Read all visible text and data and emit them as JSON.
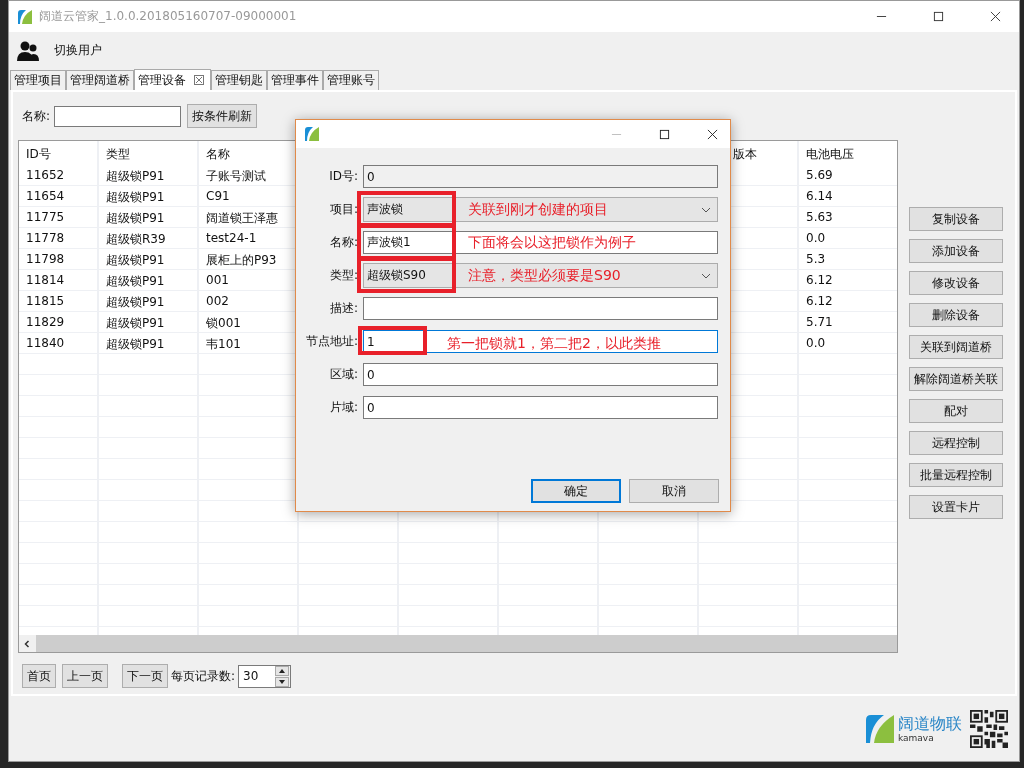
{
  "window": {
    "title": "阔道云管家_1.0.0.201805160707-09000001"
  },
  "toolbar": {
    "switch_user": "切换用户"
  },
  "tabs": [
    {
      "label": "管理项目",
      "selected": false,
      "closable": false
    },
    {
      "label": "管理阔道桥",
      "selected": false,
      "closable": false
    },
    {
      "label": "管理设备",
      "selected": true,
      "closable": true
    },
    {
      "label": "管理钥匙",
      "selected": false,
      "closable": false
    },
    {
      "label": "管理事件",
      "selected": false,
      "closable": false
    },
    {
      "label": "管理账号",
      "selected": false,
      "closable": false
    }
  ],
  "filter": {
    "label": "名称:",
    "button": "按条件刷新"
  },
  "table": {
    "columns": [
      {
        "label": "ID号"
      },
      {
        "label": "类型"
      },
      {
        "label": "名称"
      },
      {},
      {},
      {},
      {},
      {
        "label": "版本"
      },
      {
        "label": "电池电压"
      }
    ],
    "rows": [
      {
        "id": "11652",
        "type": "超级锁P91",
        "name": "子账号测试",
        "battery_voltage": "5.69"
      },
      {
        "id": "11654",
        "type": "超级锁P91",
        "name": "C91",
        "battery_voltage": "6.14"
      },
      {
        "id": "11775",
        "type": "超级锁P91",
        "name": "阔道锁王泽惠",
        "battery_voltage": "5.63"
      },
      {
        "id": "11778",
        "type": "超级锁R39",
        "name": "test24-1",
        "battery_voltage": "0.0"
      },
      {
        "id": "11798",
        "type": "超级锁P91",
        "name": "展柜上的P93",
        "battery_voltage": "5.3"
      },
      {
        "id": "11814",
        "type": "超级锁P91",
        "name": "001",
        "battery_voltage": "6.12"
      },
      {
        "id": "11815",
        "type": "超级锁P91",
        "name": "002",
        "battery_voltage": "6.12"
      },
      {
        "id": "11829",
        "type": "超级锁P91",
        "name": "锁001",
        "battery_voltage": "5.71"
      },
      {
        "id": "11840",
        "type": "超级锁P91",
        "name": "韦101",
        "battery_voltage": "0.0"
      }
    ]
  },
  "side_buttons": [
    "复制设备",
    "添加设备",
    "修改设备",
    "删除设备",
    "关联到阔道桥",
    "解除阔道桥关联",
    "配对",
    "远程控制",
    "批量远程控制",
    "设置卡片"
  ],
  "pager": {
    "first": "首页",
    "prev": "上一页",
    "next": "下一页",
    "per_page_label": "每页记录数:",
    "per_page": "30"
  },
  "brand": {
    "name": "阔道物联",
    "sub": "kamava"
  },
  "dialog": {
    "fields": [
      {
        "label": "ID号:",
        "kind": "readonly",
        "value": "0"
      },
      {
        "label": "项目:",
        "kind": "select",
        "value": "声波锁",
        "annotation": "关联到刚才创建的项目"
      },
      {
        "label": "名称:",
        "kind": "text",
        "value": "声波锁1",
        "focused": false,
        "annotation": "下面将会以这把锁作为例子"
      },
      {
        "label": "类型:",
        "kind": "select",
        "value": "超级锁S90",
        "annotation": "注意，类型必须要是S90"
      },
      {
        "label": "描述:",
        "kind": "text",
        "focused": false
      },
      {
        "label": "节点地址:",
        "kind": "text",
        "value": "1",
        "focused": true,
        "annotation": "第一把锁就1，第二把2，以此类推"
      },
      {
        "label": "区域:",
        "kind": "text",
        "value": "0",
        "focused": false
      },
      {
        "label": "片域:",
        "kind": "text",
        "value": "0",
        "focused": false
      }
    ],
    "buttons": [
      {
        "label": "确定",
        "default": true
      },
      {
        "label": "取消",
        "default": false
      }
    ]
  }
}
